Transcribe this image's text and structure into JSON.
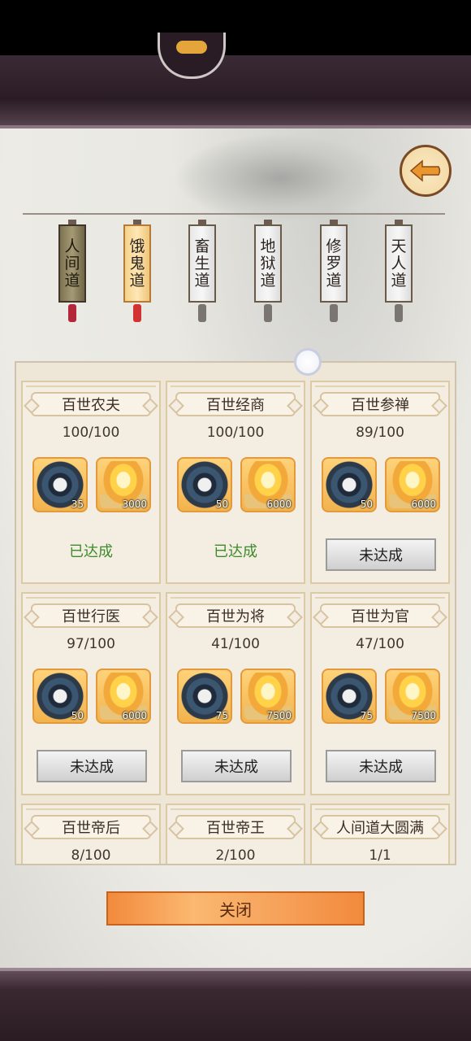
{
  "tabs": [
    {
      "label": "人间道",
      "state": "active"
    },
    {
      "label": "饿鬼道",
      "state": "selected"
    },
    {
      "label": "畜生道",
      "state": "normal"
    },
    {
      "label": "地狱道",
      "state": "normal"
    },
    {
      "label": "修罗道",
      "state": "normal"
    },
    {
      "label": "天人道",
      "state": "normal"
    }
  ],
  "cards": [
    {
      "title": "百世农夫",
      "progress": "100/100",
      "rewards": [
        {
          "icon": "taiji-compass-icon",
          "qty": "35"
        },
        {
          "icon": "flame-incense-icon",
          "qty": "3000"
        }
      ],
      "status": "已达成",
      "achieved": true
    },
    {
      "title": "百世经商",
      "progress": "100/100",
      "rewards": [
        {
          "icon": "taiji-compass-icon",
          "qty": "50"
        },
        {
          "icon": "flame-incense-icon",
          "qty": "6000"
        }
      ],
      "status": "已达成",
      "achieved": true
    },
    {
      "title": "百世参禅",
      "progress": "89/100",
      "rewards": [
        {
          "icon": "taiji-compass-icon",
          "qty": "50"
        },
        {
          "icon": "flame-incense-icon",
          "qty": "6000"
        }
      ],
      "status": "未达成",
      "achieved": false
    },
    {
      "title": "百世行医",
      "progress": "97/100",
      "rewards": [
        {
          "icon": "taiji-compass-icon",
          "qty": "50"
        },
        {
          "icon": "flame-incense-icon",
          "qty": "6000"
        }
      ],
      "status": "未达成",
      "achieved": false
    },
    {
      "title": "百世为将",
      "progress": "41/100",
      "rewards": [
        {
          "icon": "taiji-compass-icon",
          "qty": "75"
        },
        {
          "icon": "flame-incense-icon",
          "qty": "7500"
        }
      ],
      "status": "未达成",
      "achieved": false
    },
    {
      "title": "百世为官",
      "progress": "47/100",
      "rewards": [
        {
          "icon": "taiji-compass-icon",
          "qty": "75"
        },
        {
          "icon": "flame-incense-icon",
          "qty": "7500"
        }
      ],
      "status": "未达成",
      "achieved": false
    },
    {
      "title": "百世帝后",
      "progress": "8/100"
    },
    {
      "title": "百世帝王",
      "progress": "2/100"
    },
    {
      "title": "人间道大圆满",
      "progress": "1/1"
    }
  ],
  "close_label": "关闭",
  "colors": {
    "achieved": "#3d8a2a",
    "close_button": "#f28a3c",
    "active_tab": "#8a8060"
  }
}
